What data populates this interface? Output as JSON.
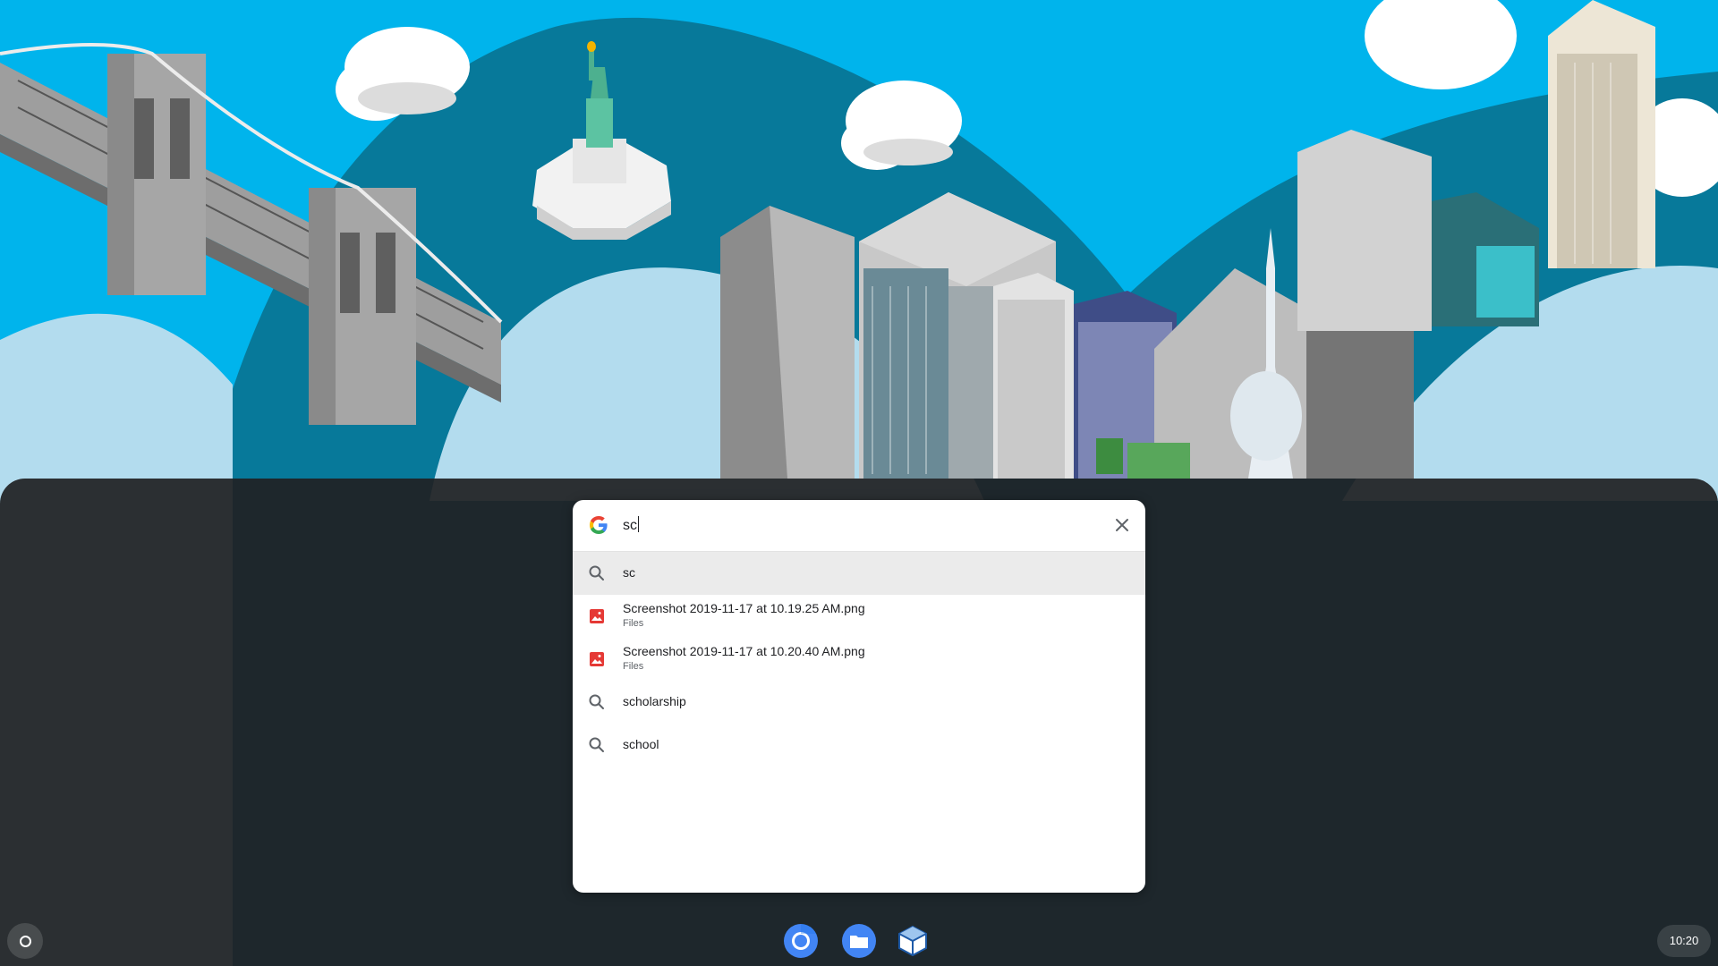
{
  "search": {
    "query": "sc",
    "provider_icon": "google-g-icon",
    "clear_icon": "close-icon"
  },
  "results": [
    {
      "type": "query",
      "title": "sc",
      "subtitle": "",
      "icon": "search-icon"
    },
    {
      "type": "file",
      "title": "Screenshot 2019-11-17 at 10.19.25 AM.png",
      "subtitle": "Files",
      "icon": "image-file-icon"
    },
    {
      "type": "file",
      "title": "Screenshot 2019-11-17 at 10.20.40 AM.png",
      "subtitle": "Files",
      "icon": "image-file-icon"
    },
    {
      "type": "query",
      "title": "scholarship",
      "subtitle": "",
      "icon": "search-icon"
    },
    {
      "type": "query",
      "title": "school",
      "subtitle": "",
      "icon": "search-icon"
    }
  ],
  "shelf": {
    "launcher_icon": "launcher-circle-icon",
    "apps": [
      "chrome-icon",
      "files-icon",
      "virtualbox-icon"
    ],
    "time": "10:20"
  },
  "colors": {
    "sky": "#00b4ec",
    "teal": "#07799a",
    "panel": "#202124",
    "file_icon_red": "#e53935",
    "chrome_blue": "#4285f4"
  }
}
